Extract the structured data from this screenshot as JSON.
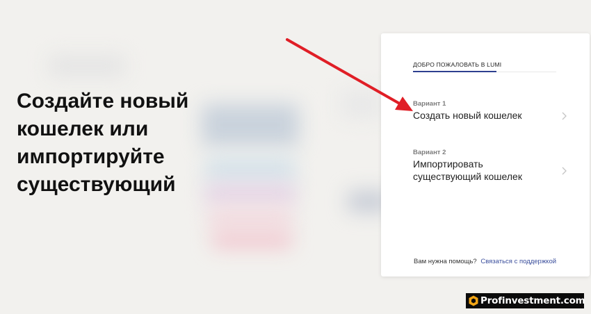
{
  "headline": "Создайте новый кошелек или импортируйте существующий",
  "card": {
    "tab_label": "ДОБРО ПОЖАЛОВАТЬ В LUMI",
    "options": [
      {
        "label": "Вариант 1",
        "title": "Создать новый кошелек"
      },
      {
        "label": "Вариант 2",
        "title": "Импортировать существующий кошелек"
      }
    ],
    "help_text": "Вам нужна помощь?",
    "help_link": "Связаться с поддержкой"
  },
  "watermark": "Profinvestment.com",
  "colors": {
    "accent": "#2d3f8f",
    "arrow": "#e01e26",
    "link": "#3a4e9c"
  },
  "icons": [
    "chevron-right-icon",
    "red-arrow-annotation",
    "profinvestment-logo-icon"
  ]
}
